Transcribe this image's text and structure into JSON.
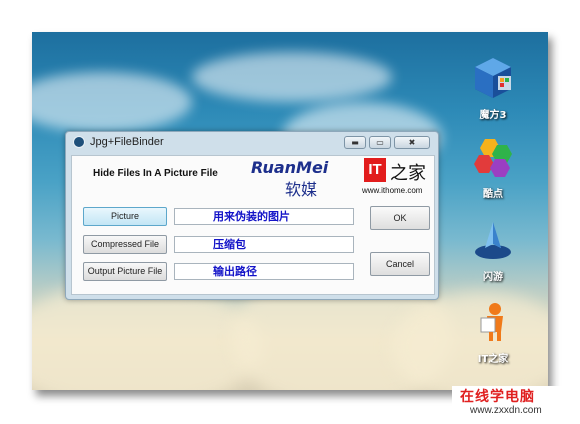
{
  "desktop": {
    "icons": [
      {
        "name": "mofang-icon",
        "label": "魔方3"
      },
      {
        "name": "kudian-icon",
        "label": "酷点"
      },
      {
        "name": "shanyou-icon",
        "label": "闪游"
      },
      {
        "name": "itzhijia-icon",
        "label": "IT之家"
      }
    ]
  },
  "window": {
    "title": "Jpg+FileBinder",
    "controls": {
      "minimize": "▬",
      "maximize": "▭",
      "close": "✖"
    },
    "header": "Hide Files In A Picture File",
    "brand": {
      "ruanmei_en": "RuanMei",
      "ruanmei_cn": "软媒",
      "it_logo": "IT",
      "it_char": "之家",
      "it_url": "www.ithome.com"
    },
    "rows": [
      {
        "button": "Picture",
        "value": "用来伪装的图片"
      },
      {
        "button": "Compressed File",
        "value": "压缩包"
      },
      {
        "button": "Output Picture File",
        "value": "输出路径"
      }
    ],
    "ok_label": "OK",
    "cancel_label": "Cancel"
  },
  "watermark": {
    "line1": "在线学电脑",
    "line2": "www.zxxdn.com"
  }
}
